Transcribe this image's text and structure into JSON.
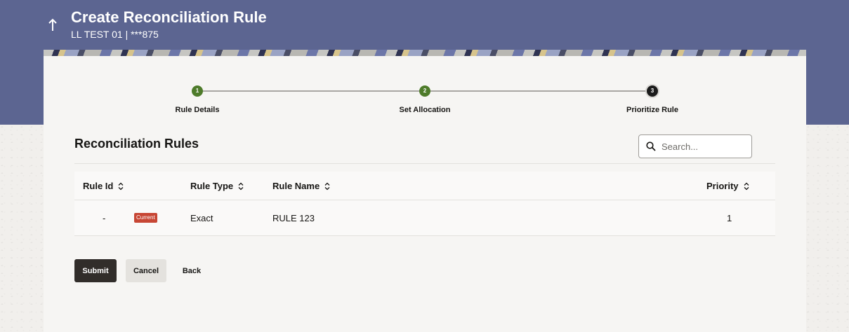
{
  "header": {
    "title": "Create Reconciliation Rule",
    "subtitle": "LL TEST 01 | ***875",
    "back_icon": "arrow-up-icon",
    "background_color": "#5c6591"
  },
  "stepper": {
    "steps": [
      {
        "number": "1",
        "label": "Rule Details",
        "status": "done"
      },
      {
        "number": "2",
        "label": "Set Allocation",
        "status": "done"
      },
      {
        "number": "3",
        "label": "Prioritize Rule",
        "status": "current"
      }
    ],
    "done_color": "#4e7b2a",
    "current_color": "#1b1b1b"
  },
  "section": {
    "title": "Reconciliation Rules"
  },
  "search": {
    "placeholder": "Search...",
    "value": "",
    "icon": "search-icon"
  },
  "table": {
    "columns": [
      {
        "label": "Rule Id",
        "sortable": true
      },
      {
        "label": "Rule Type",
        "sortable": true
      },
      {
        "label": "Rule Name",
        "sortable": true
      },
      {
        "label": "Priority",
        "sortable": true
      }
    ],
    "rows": [
      {
        "rule_id": "-",
        "badge": "Current",
        "rule_type": "Exact",
        "rule_name": "RULE 123",
        "priority": "1"
      }
    ],
    "badge_color": "#c74634"
  },
  "actions": {
    "submit_label": "Submit",
    "cancel_label": "Cancel",
    "back_label": "Back"
  }
}
